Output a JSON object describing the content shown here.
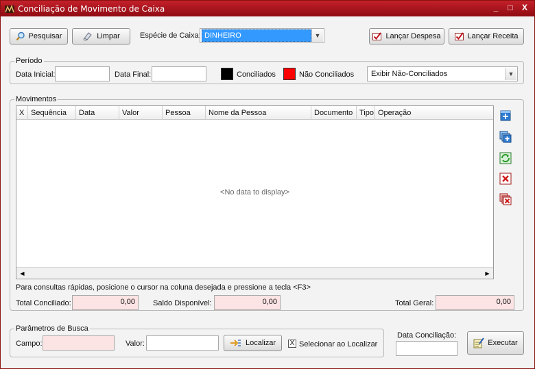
{
  "window": {
    "title": "Conciliação de Movimento de Caixa",
    "minimize": "_",
    "restore": "□",
    "close": "X"
  },
  "toolbar": {
    "pesquisar": "Pesquisar",
    "limpar": "Limpar",
    "especie_label": "Espécie de Caixa:",
    "especie_value": "DINHEIRO",
    "lancar_despesa": "Lançar Despesa",
    "lancar_receita": "Lançar Receita"
  },
  "periodo": {
    "legend": "Período",
    "data_inicial_label": "Data Inicial:",
    "data_inicial_value": "",
    "data_final_label": "Data Final:",
    "data_final_value": "",
    "conciliados": "Conciliados",
    "nao_conciliados": "Não Conciliados",
    "filtro_value": "Exibir Não-Conciliados",
    "color_conciliados": "#000000",
    "color_nao_conciliados": "#ff0000"
  },
  "movimentos": {
    "legend": "Movimentos",
    "columns": [
      "X",
      "Sequência",
      "Data",
      "Valor",
      "Pessoa",
      "Nome da Pessoa",
      "Documento",
      "Tipo",
      "Operação"
    ],
    "rows": [],
    "empty_text": "<No data to display>",
    "hint": "Para consultas rápidas, posicione o cursor na coluna desejada e pressione a tecla <F3>",
    "side_icons": [
      "add-record-icon",
      "add-multiple-icon",
      "refresh-icon",
      "delete-record-icon",
      "delete-multiple-icon"
    ]
  },
  "totais": {
    "total_conciliado_label": "Total Conciliado:",
    "total_conciliado_value": "0,00",
    "saldo_disponivel_label": "Saldo Disponível:",
    "saldo_disponivel_value": "0,00",
    "total_geral_label": "Total Geral:",
    "total_geral_value": "0,00"
  },
  "busca": {
    "legend": "Parâmetros de Busca",
    "campo_label": "Campo:",
    "campo_value": "",
    "valor_label": "Valor:",
    "valor_value": "",
    "localizar": "Localizar",
    "selecionar_mark": "X",
    "selecionar_label": "Selecionar ao Localizar",
    "selecionar_checked": true
  },
  "conciliacao": {
    "data_label": "Data Conciliação:",
    "data_value": "",
    "executar": "Executar"
  },
  "colors": {
    "title_bar": "#b0141c",
    "selection": "#3399ff",
    "pink_field": "#fde4e4"
  }
}
